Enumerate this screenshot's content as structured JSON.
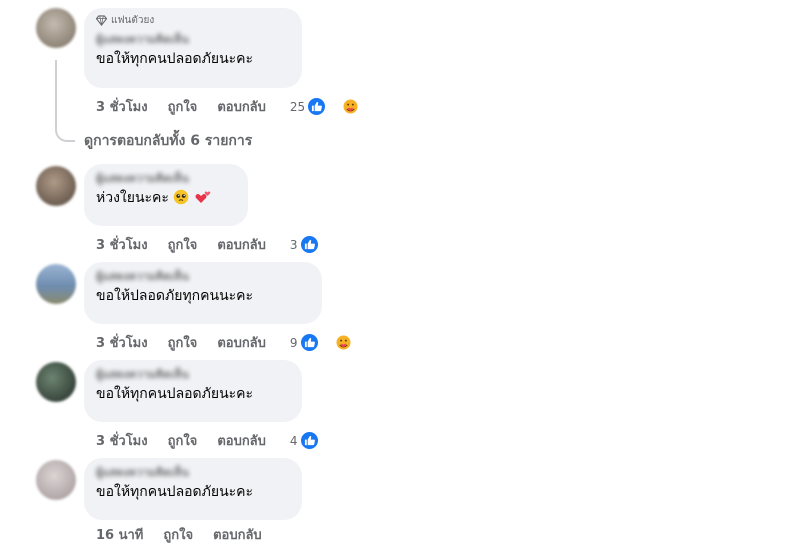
{
  "thread": {
    "view_replies": "ดูการตอบกลับทั้ง 6 รายการ"
  },
  "labels": {
    "like": "ถูกใจ",
    "reply": "ตอบกลับ",
    "fan_badge": "แฟนตัวยง"
  },
  "comments": [
    {
      "author": "ผู้แสดงความคิดเห็น",
      "badge": "แฟนตัวยง",
      "text": "ขอให้ทุกคนปลอดภัยนะคะ",
      "time": "3 ชั่วโมง",
      "reaction_count": "25",
      "reactions": [
        "like-icon",
        "care-icon"
      ],
      "avatar_color": "#a39a8e"
    },
    {
      "author": "ผู้แสดงความคิดเห็น",
      "text": "ห่วงใยนะคะ",
      "emoji": [
        "pleading-face-icon",
        "two-hearts-icon"
      ],
      "time": "3 ชั่วโมง",
      "reaction_count": "3",
      "reactions": [
        "like-icon"
      ],
      "avatar_color": "#8a7a6c"
    },
    {
      "author": "ผู้แสดงความคิดเห็น",
      "text": "ขอให้ปลอดภัยทุกคนนะคะ",
      "time": "3 ชั่วโมง",
      "reaction_count": "9",
      "reactions": [
        "like-icon",
        "care-icon"
      ],
      "avatar_color": "#7a92ad"
    },
    {
      "author": "ผู้แสดงความคิดเห็น",
      "text": "ขอให้ทุกคนปลอดภัยนะคะ",
      "time": "3 ชั่วโมง",
      "reaction_count": "4",
      "reactions": [
        "like-icon"
      ],
      "avatar_color": "#4f6151"
    },
    {
      "author": "ผู้แสดงความคิดเห็น",
      "text": "ขอให้ทุกคนปลอดภัยนะคะ",
      "time": "16 นาที",
      "reaction_count": "",
      "reactions": [],
      "avatar_color": "#c9bfbf"
    }
  ],
  "colors": {
    "bubble": "#f0f2f5",
    "meta": "#65676b",
    "like_blue": "#1877f2"
  }
}
